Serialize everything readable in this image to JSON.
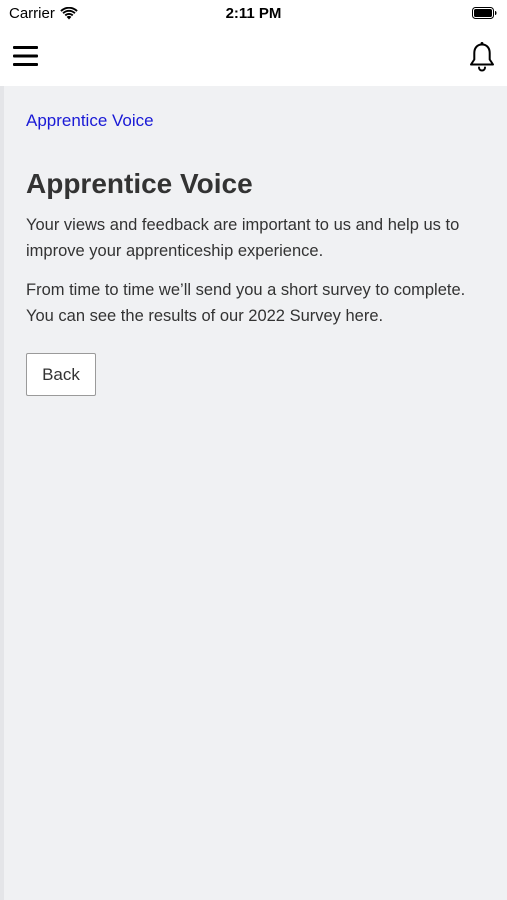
{
  "status_bar": {
    "carrier": "Carrier",
    "time": "2:11 PM"
  },
  "header": {
    "menu_icon": "hamburger-menu-icon",
    "notification_icon": "bell-icon"
  },
  "main": {
    "breadcrumb": "Apprentice Voice",
    "title": "Apprentice Voice",
    "paragraphs": [
      "Your views and feedback are important to us and help us to improve your apprenticeship experience.",
      "From time to time we’ll send you a short survey to complete. You can see the results of our 2022 Survey here."
    ],
    "back_button": "Back"
  },
  "colors": {
    "background": "#f0f1f3",
    "link": "#1a1ad6",
    "text": "#333333",
    "header": "#ffffff"
  }
}
